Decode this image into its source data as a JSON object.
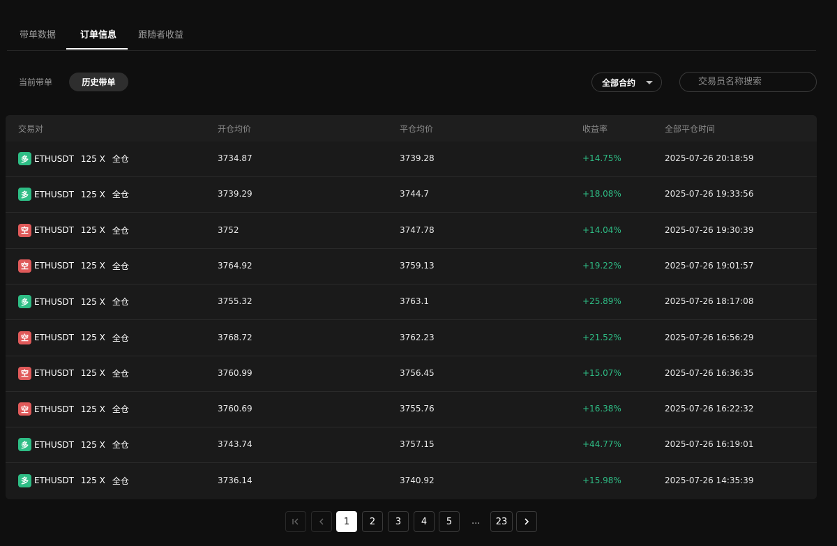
{
  "tabs": [
    {
      "label": "带单数据"
    },
    {
      "label": "订单信息",
      "active": true
    },
    {
      "label": "跟随者收益"
    }
  ],
  "subtabs": {
    "current": "当前带单",
    "history": "历史带单"
  },
  "filter": {
    "contract_select": "全部合约",
    "search_placeholder": "交易员名称搜索"
  },
  "table": {
    "columns": [
      "交易对",
      "开仓均价",
      "平仓均价",
      "收益率",
      "全部平仓时间"
    ],
    "rows": [
      {
        "side": "long",
        "side_label": "多",
        "pair": "ETHUSDT",
        "leverage": "125 X",
        "mode": "全仓",
        "open": "3734.87",
        "close": "3739.28",
        "pnl": "+14.75%",
        "time": "2025-07-26 20:18:59"
      },
      {
        "side": "long",
        "side_label": "多",
        "pair": "ETHUSDT",
        "leverage": "125 X",
        "mode": "全仓",
        "open": "3739.29",
        "close": "3744.7",
        "pnl": "+18.08%",
        "time": "2025-07-26 19:33:56"
      },
      {
        "side": "short",
        "side_label": "空",
        "pair": "ETHUSDT",
        "leverage": "125 X",
        "mode": "全仓",
        "open": "3752",
        "close": "3747.78",
        "pnl": "+14.04%",
        "time": "2025-07-26 19:30:39"
      },
      {
        "side": "short",
        "side_label": "空",
        "pair": "ETHUSDT",
        "leverage": "125 X",
        "mode": "全仓",
        "open": "3764.92",
        "close": "3759.13",
        "pnl": "+19.22%",
        "time": "2025-07-26 19:01:57"
      },
      {
        "side": "long",
        "side_label": "多",
        "pair": "ETHUSDT",
        "leverage": "125 X",
        "mode": "全仓",
        "open": "3755.32",
        "close": "3763.1",
        "pnl": "+25.89%",
        "time": "2025-07-26 18:17:08"
      },
      {
        "side": "short",
        "side_label": "空",
        "pair": "ETHUSDT",
        "leverage": "125 X",
        "mode": "全仓",
        "open": "3768.72",
        "close": "3762.23",
        "pnl": "+21.52%",
        "time": "2025-07-26 16:56:29"
      },
      {
        "side": "short",
        "side_label": "空",
        "pair": "ETHUSDT",
        "leverage": "125 X",
        "mode": "全仓",
        "open": "3760.99",
        "close": "3756.45",
        "pnl": "+15.07%",
        "time": "2025-07-26 16:36:35"
      },
      {
        "side": "short",
        "side_label": "空",
        "pair": "ETHUSDT",
        "leverage": "125 X",
        "mode": "全仓",
        "open": "3760.69",
        "close": "3755.76",
        "pnl": "+16.38%",
        "time": "2025-07-26 16:22:32"
      },
      {
        "side": "long",
        "side_label": "多",
        "pair": "ETHUSDT",
        "leverage": "125 X",
        "mode": "全仓",
        "open": "3743.74",
        "close": "3757.15",
        "pnl": "+44.77%",
        "time": "2025-07-26 16:19:01"
      },
      {
        "side": "long",
        "side_label": "多",
        "pair": "ETHUSDT",
        "leverage": "125 X",
        "mode": "全仓",
        "open": "3736.14",
        "close": "3740.92",
        "pnl": "+15.98%",
        "time": "2025-07-26 14:35:39"
      }
    ]
  },
  "pagination": {
    "first_icon": "first-page-icon",
    "prev_icon": "chevron-left-icon",
    "pages": [
      "1",
      "2",
      "3",
      "4",
      "5"
    ],
    "current": "1",
    "ellipsis": "...",
    "last": "23",
    "next_icon": "chevron-right-icon"
  },
  "colors": {
    "background": "#0f0f0f",
    "panel": "#1a1a1a",
    "long": "#2ebd85",
    "short": "#e05a5a",
    "profit": "#2ebd85"
  }
}
